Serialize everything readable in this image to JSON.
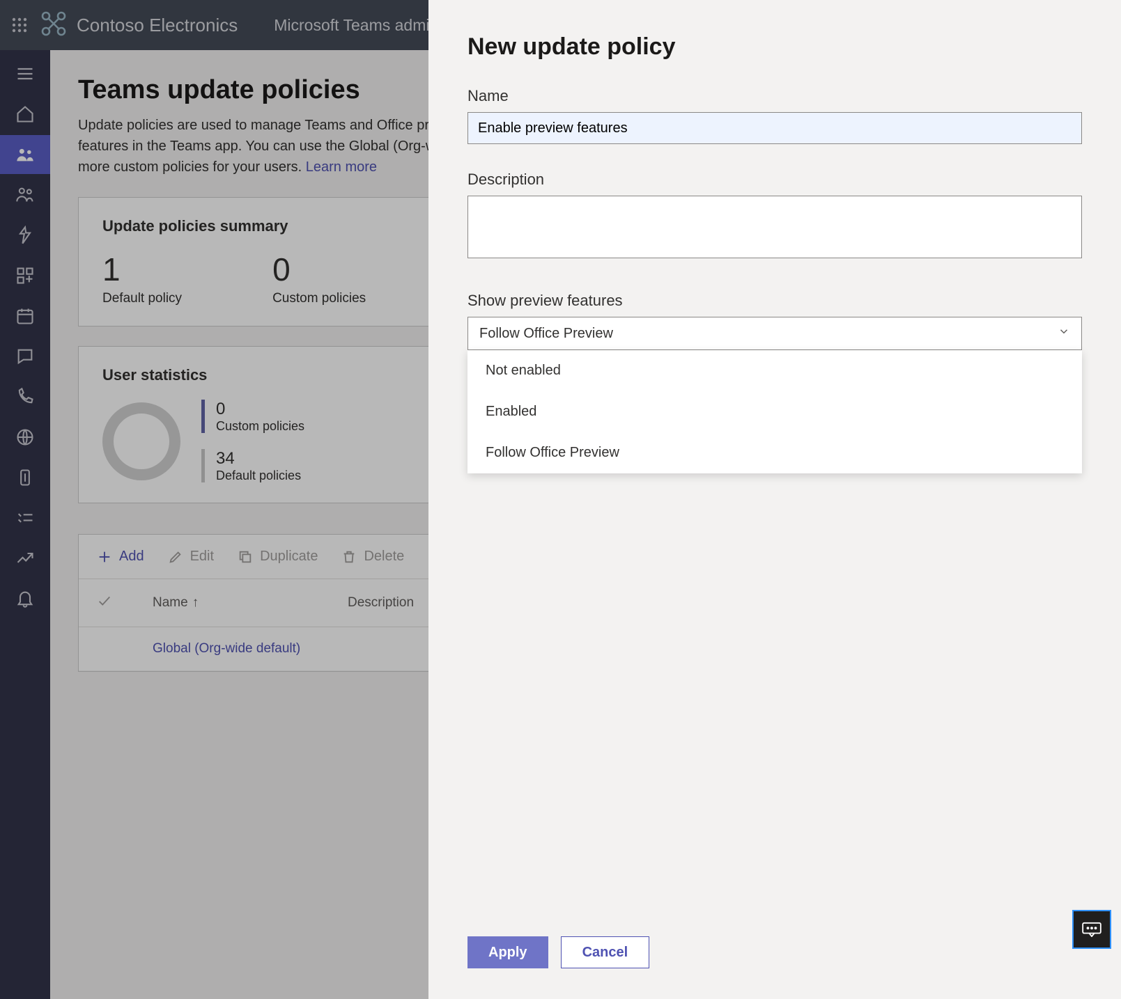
{
  "header": {
    "brand": "Contoso Electronics",
    "app_title": "Microsoft Teams admin center"
  },
  "page": {
    "title": "Teams update policies",
    "description": "Update policies are used to manage Teams and Office preview users that will see pre-release or preview features in the Teams app. You can use the Global (Org-wide default) policy and customize it or create one or more custom policies for your users. ",
    "learn_more": "Learn more"
  },
  "summary": {
    "heading": "Update policies summary",
    "default_count": "1",
    "default_label": "Default policy",
    "custom_count": "0",
    "custom_label": "Custom policies"
  },
  "user_stats": {
    "heading": "User statistics",
    "custom_count": "0",
    "custom_label": "Custom policies",
    "default_count": "34",
    "default_label": "Default policies"
  },
  "toolbar": {
    "add": "Add",
    "edit": "Edit",
    "duplicate": "Duplicate",
    "delete": "Delete"
  },
  "table": {
    "col_name": "Name",
    "col_desc": "Description",
    "rows": [
      {
        "name": "Global (Org-wide default)",
        "description": ""
      }
    ]
  },
  "panel": {
    "title": "New update policy",
    "name_label": "Name",
    "name_value": "Enable preview features",
    "desc_label": "Description",
    "desc_value": "",
    "select_label": "Show preview features",
    "select_value": "Follow Office Preview",
    "options": [
      "Not enabled",
      "Enabled",
      "Follow Office Preview"
    ],
    "apply": "Apply",
    "cancel": "Cancel"
  }
}
